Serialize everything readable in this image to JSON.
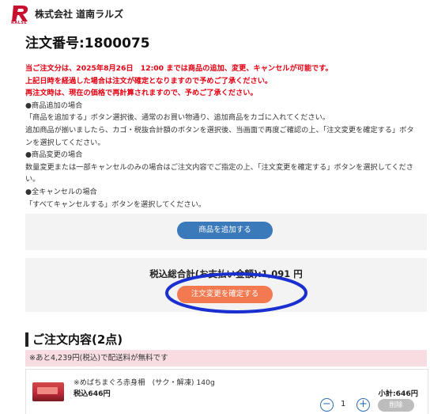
{
  "header": {
    "company": "株式会社 道南ラルズ",
    "logo_sub": "RALSE"
  },
  "order": {
    "title": "注文番号:1800075"
  },
  "notice": {
    "red_lines": [
      "当ご注文分は、2025年8月26日　12:00 までは商品の追加、変更、キャンセルが可能です。",
      "上記日時を経過した場合は注文が確定となりますので予めご了承ください。",
      "再注文時は、現在の価格で再計算されますので、予めご了承ください。"
    ],
    "lines": [
      "●商品追加の場合",
      "「商品を追加する」ボタン選択後、通常のお買い物通り、追加商品をカゴに入れてください。",
      "追加商品が揃いましたら、カゴ・税抜合計額のボタンを選択後、当画面で再度ご確認の上、「注文変更を確定する」ボタンを選択してください。",
      "●商品変更の場合",
      "数量変更または一部キャンセルのみの場合はご注文内容でご指定の上、「注文変更を確定する」ボタンを選択してください。",
      "●全キャンセルの場合",
      "「すべてキャンセルする」ボタンを選択してください。"
    ]
  },
  "actions": {
    "add_label": "商品を追加する",
    "total_text": "税込総合計(お支払い金額):1,091 円",
    "confirm_label": "注文変更を確定する"
  },
  "contents": {
    "title": "ご注文内容(2点)",
    "shipping_note": "※あと4,239円(税込)で配送料が無料です"
  },
  "item": {
    "name": "※めばちまぐろ赤身柵　(サク・解凍) 140g",
    "price": "税込646円",
    "subtotal": "小計:646円",
    "quantity": "1",
    "minus": "−",
    "plus": "+",
    "delete_label": "削除"
  },
  "colors": {
    "accent_blue": "#3a79ba",
    "confirm_orange": "#f37a50",
    "notice_red": "#e60012",
    "annotation_circle": "#1a2fd0"
  }
}
